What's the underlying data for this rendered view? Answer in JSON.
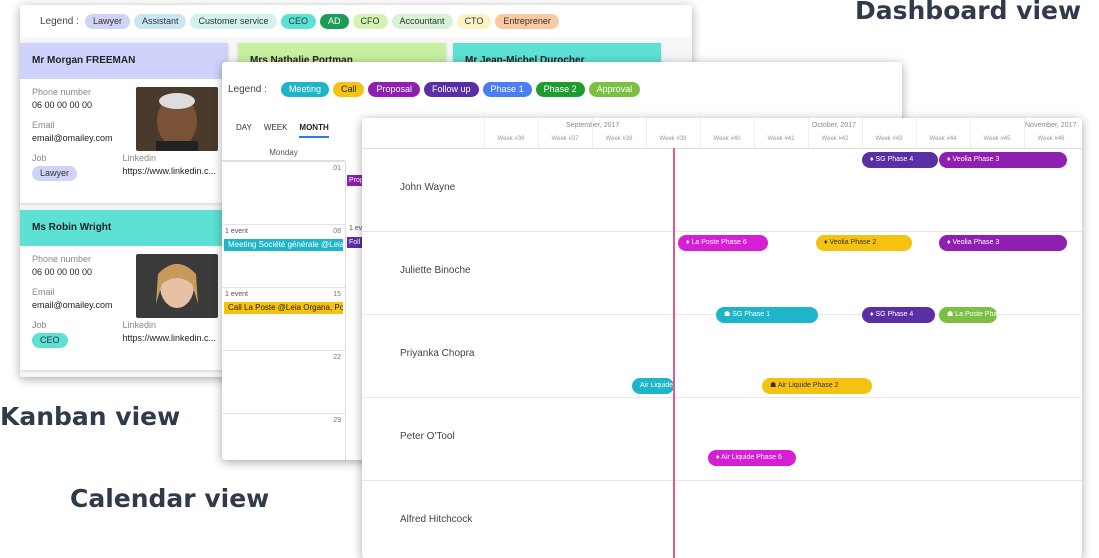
{
  "labels": {
    "dashboard": "Dashboard view",
    "kanban": "Kanban view",
    "calendar": "Calendar view"
  },
  "kanban": {
    "legend_title": "Legend :",
    "legend": [
      {
        "label": "Lawyer",
        "color": "#cfd3f5"
      },
      {
        "label": "Assistant",
        "color": "#c9e8f3"
      },
      {
        "label": "Customer service",
        "color": "#d2f2ee"
      },
      {
        "label": "CEO",
        "color": "#5de1d5"
      },
      {
        "label": "AD",
        "color": "#1e9c57",
        "text": "#ffffff"
      },
      {
        "label": "CFO",
        "color": "#d4f3b3"
      },
      {
        "label": "Accountant",
        "color": "#d8f3d4"
      },
      {
        "label": "CTO",
        "color": "#fbf3c3"
      },
      {
        "label": "Entreprener",
        "color": "#f9caa2"
      }
    ],
    "cards": [
      {
        "name": "Mr Morgan FREEMAN",
        "color": "#cfd3fb",
        "phone_label": "Phone number",
        "phone": "06 00 00 00 00",
        "email_label": "Email",
        "email": "email@omailey.com",
        "job_label": "Job",
        "job": "Lawyer",
        "job_color": "#cfd3f5",
        "linkedin_label": "Linkedin",
        "linkedin": "https://www.linkedin.c..."
      },
      {
        "name": "Ms Robin Wright",
        "color": "#5de1d5",
        "phone_label": "Phone number",
        "phone": "06 00 00 00 00",
        "email_label": "Email",
        "email": "email@omailey.com",
        "job_label": "Job",
        "job": "CEO",
        "job_color": "#5de1d5",
        "linkedin_label": "Linkedin",
        "linkedin": "https://www.linkedin.c..."
      }
    ],
    "top_cards": [
      {
        "name": "Mrs Nathalie Portman",
        "color": "#c8f0a0"
      },
      {
        "name": "Mr Jean-Michel Durocher",
        "color": "#5de1d5"
      }
    ]
  },
  "calendar": {
    "legend_title": "Legend :",
    "legend": [
      {
        "label": "Meeting",
        "color": "#1fb5c9"
      },
      {
        "label": "Call",
        "color": "#f5c211",
        "text": "#222"
      },
      {
        "label": "Proposal",
        "color": "#8e1fb0"
      },
      {
        "label": "Follow up",
        "color": "#5a2fa6"
      },
      {
        "label": "Phase 1",
        "color": "#4a7ef5"
      },
      {
        "label": "Phase 2",
        "color": "#1e9c2f"
      },
      {
        "label": "Approval",
        "color": "#7bc043"
      }
    ],
    "tabs": [
      "DAY",
      "WEEK",
      "MONTH"
    ],
    "active_tab": "MONTH",
    "column_header": "Monday",
    "rows": [
      {
        "day": "01",
        "count": "",
        "event": "",
        "event_color": ""
      },
      {
        "day": "08",
        "count": "1 event",
        "event": "Meeting Société générale @Leia",
        "event_color": "#1fb5c9"
      },
      {
        "day": "15",
        "count": "1 event",
        "event": "Call La Poste @Leia Organa, Poe",
        "event_color": "#f5c211"
      },
      {
        "day": "22",
        "count": "",
        "event": "",
        "event_color": ""
      },
      {
        "day": "29",
        "count": "",
        "event": "",
        "event_color": ""
      }
    ],
    "side_events": [
      "Prop",
      "1 eve",
      "Foll"
    ]
  },
  "dashboard": {
    "months": [
      "September, 2017",
      "October, 2017",
      "November, 2017"
    ],
    "weeks": [
      "Week #36",
      "Week #37",
      "Week #38",
      "Week #39",
      "Week #40",
      "Week #41",
      "Week #42",
      "Week #43",
      "Week #44",
      "Week #45",
      "Week #46"
    ],
    "people": [
      "John Wayne",
      "Juliette Binoche",
      "Priyanka Chopra",
      "Peter O'Tool",
      "Alfred Hitchcock"
    ],
    "bars": [
      {
        "label": "♦ SG Phase 4",
        "color": "#5a2fa6",
        "row": 0
      },
      {
        "label": "♦ Veolia Phase 3",
        "color": "#8e1fb0",
        "row": 0
      },
      {
        "label": "♦ La Poste Phase 6",
        "color": "#d41fd4",
        "row": 1
      },
      {
        "label": "♦ Veolia Phase 2",
        "color": "#f5c211",
        "row": 1
      },
      {
        "label": "♦ Veolia Phase 3",
        "color": "#8e1fb0",
        "row": 1
      },
      {
        "label": "☗ SG Phase 1",
        "color": "#1fb5c9",
        "row": 2
      },
      {
        "label": "♦ SG Phase 4",
        "color": "#5a2fa6",
        "row": 2
      },
      {
        "label": "☗ La Poste Pha",
        "color": "#7bc043",
        "row": 2
      },
      {
        "label": "Air Liquide",
        "color": "#1fb5c9",
        "row": 3
      },
      {
        "label": "☗ Air Liquide Phase 2",
        "color": "#f5c211",
        "row": 3
      },
      {
        "label": "♦ Air Liquide Phase 6",
        "color": "#d41fd4",
        "row": 4
      }
    ]
  }
}
